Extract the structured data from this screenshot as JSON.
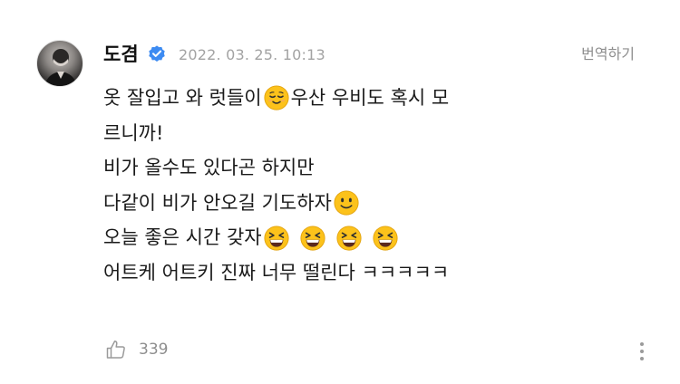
{
  "post": {
    "author": "도겸",
    "timestamp": "2022. 03. 25. 10:13",
    "translate_label": "번역하기",
    "lines": [
      [
        "옷 잘입고 와 럿들이",
        "😌",
        "우산 우비도 혹시 모"
      ],
      [
        "르니까!"
      ],
      [
        "비가 올수도 있다곤 하지만"
      ],
      [
        "다같이 비가 안오길 기도하자",
        "🙂"
      ],
      [
        "오늘 좋은 시간 갖자",
        "😆",
        "😆",
        "😆",
        "😆"
      ],
      [
        "어트케 어트키 진짜 너무 떨린다 ㅋㅋㅋㅋㅋ"
      ]
    ],
    "line_1_text_a": "옷 잘입고 와 럿들이",
    "line_1_text_b": "우산 우비도 혹시 모",
    "line_2_text": "르니까!",
    "line_3_text": "비가 올수도 있다곤 하지만",
    "line_4_text": "다같이 비가 안오길 기도하자",
    "line_5_text": "오늘 좋은 시간 갖자",
    "line_6_text": "어트케 어트키 진짜 너무 떨린다 ㅋㅋㅋㅋㅋ",
    "like_count": "339"
  },
  "icons": {
    "verified": "verified-badge-icon",
    "like": "thumbs-up-icon",
    "more": "vertical-ellipsis-icon",
    "emoji_relieved": "relieved-face-emoji",
    "emoji_smile": "slightly-smiling-face-emoji",
    "emoji_laugh": "grinning-squinting-face-emoji"
  },
  "colors": {
    "verified_blue": "#3d8bf2",
    "text_main": "#1a1a1a",
    "text_muted": "#8e8e8e",
    "emoji_yellow": "#fcc21b"
  }
}
